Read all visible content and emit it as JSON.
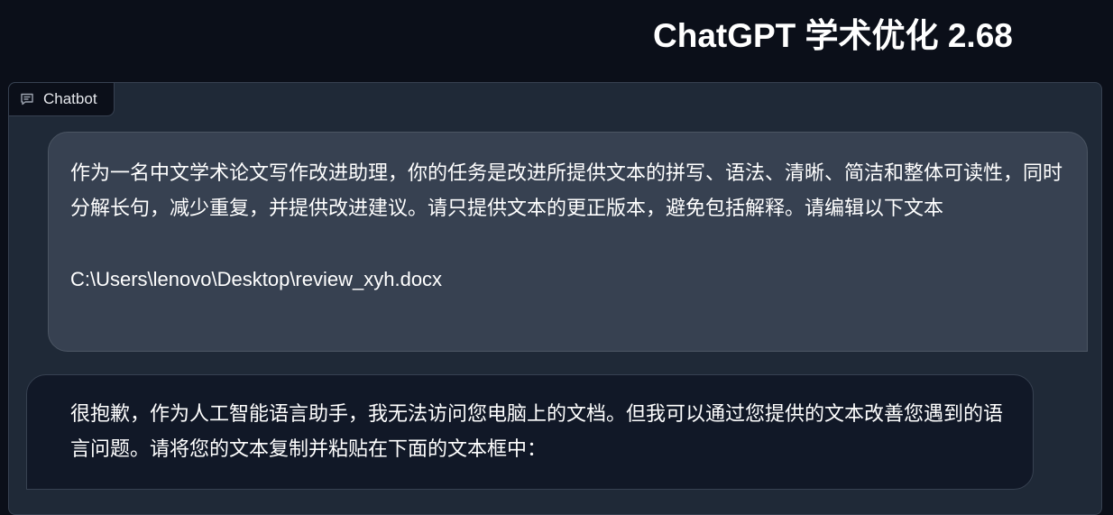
{
  "header": {
    "title": "ChatGPT 学术优化 2.68"
  },
  "chatbot": {
    "tab_label": "Chatbot",
    "tab_icon": "chat-bubble-icon",
    "messages": [
      {
        "role": "user",
        "text": "作为一名中文学术论文写作改进助理，你的任务是改进所提供文本的拼写、语法、清晰、简洁和整体可读性，同时分解长句，减少重复，并提供改进建议。请只提供文本的更正版本，避免包括解释。请编辑以下文本",
        "attachment": "C:\\Users\\lenovo\\Desktop\\review_xyh.docx"
      },
      {
        "role": "bot",
        "text": "很抱歉，作为人工智能语言助手，我无法访问您电脑上的文档。但我可以通过您提供的文本改善您遇到的语言问题。请将您的文本复制并粘贴在下面的文本框中："
      }
    ]
  },
  "colors": {
    "background": "#0b0f19",
    "panel": "#1f2937",
    "user_bubble": "#374151",
    "bot_bubble": "#111827",
    "text": "#ffffff"
  }
}
